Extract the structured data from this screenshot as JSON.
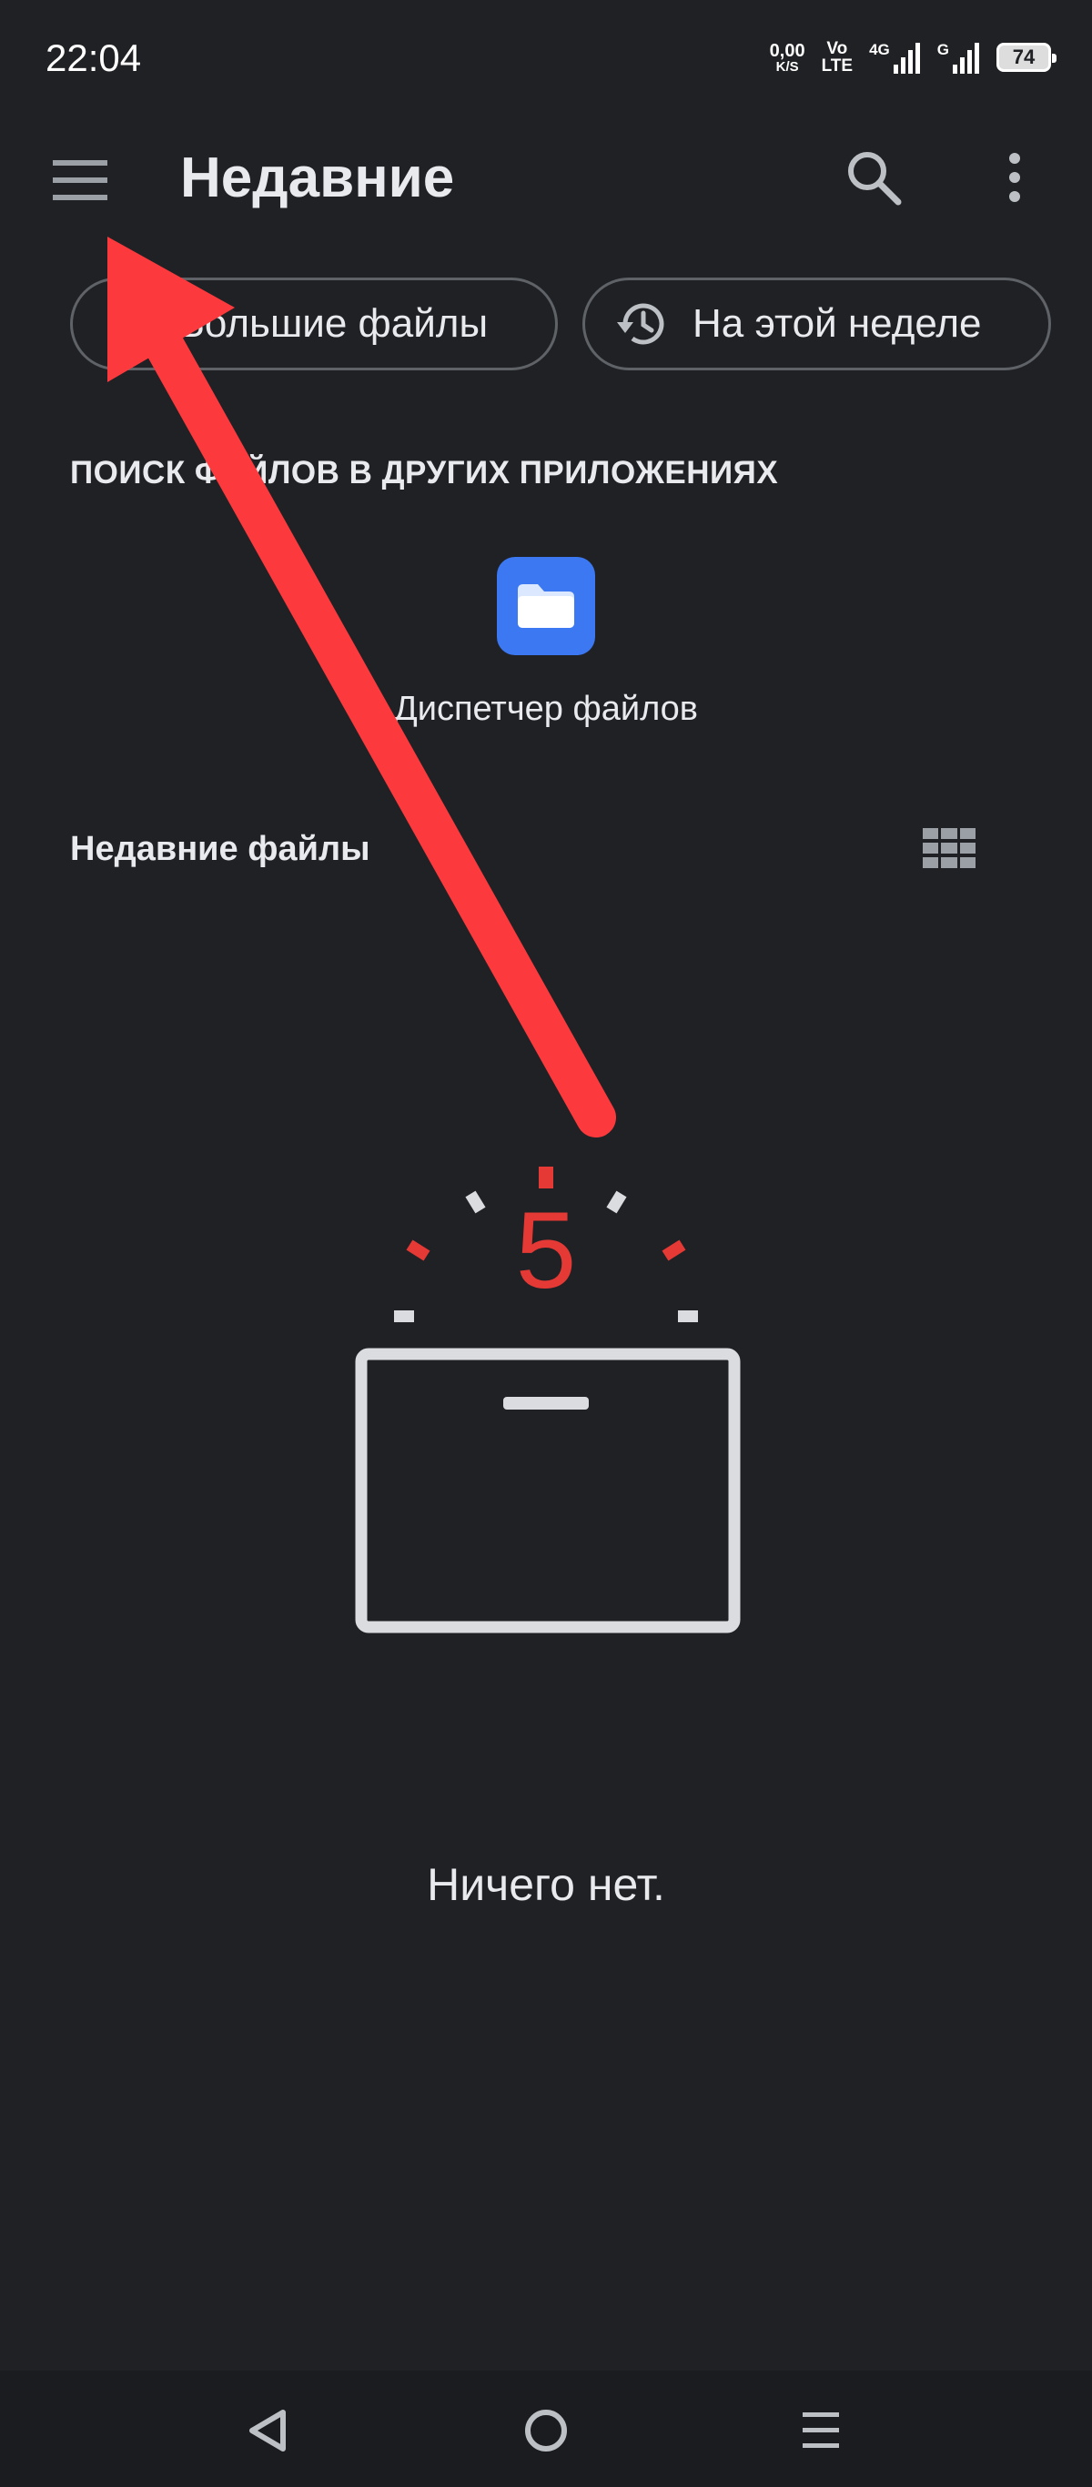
{
  "status_bar": {
    "time": "22:04",
    "net_speed_value": "0,00",
    "net_speed_unit": "K/S",
    "volte_top": "Vo",
    "volte_bottom": "LTE",
    "network_type_1": "4G",
    "network_type_2": "G",
    "battery": "74"
  },
  "app_bar": {
    "title": "Недавние",
    "icons": [
      "menu-icon",
      "search-icon",
      "more-vert-icon"
    ]
  },
  "chips": [
    {
      "label": "Большие файлы",
      "icon": "file-icon"
    },
    {
      "label": "На этой неделе",
      "icon": "history-icon"
    }
  ],
  "other_apps": {
    "heading": "ПОИСК ФАЙЛОВ В ДРУГИХ ПРИЛОЖЕНИЯХ",
    "apps": [
      {
        "label": "Диспетчер файлов",
        "icon": "folder-icon",
        "color": "#3b78f2"
      }
    ]
  },
  "recent": {
    "title": "Недавние файлы",
    "view_toggle_icon": "grid-view-icon",
    "empty_badge": "5",
    "empty_message": "Ничего нет."
  },
  "annotation": {
    "arrow_color": "#fc3a3d"
  },
  "nav_bar": {
    "icons": [
      "back-icon",
      "home-icon",
      "recents-icon"
    ]
  }
}
